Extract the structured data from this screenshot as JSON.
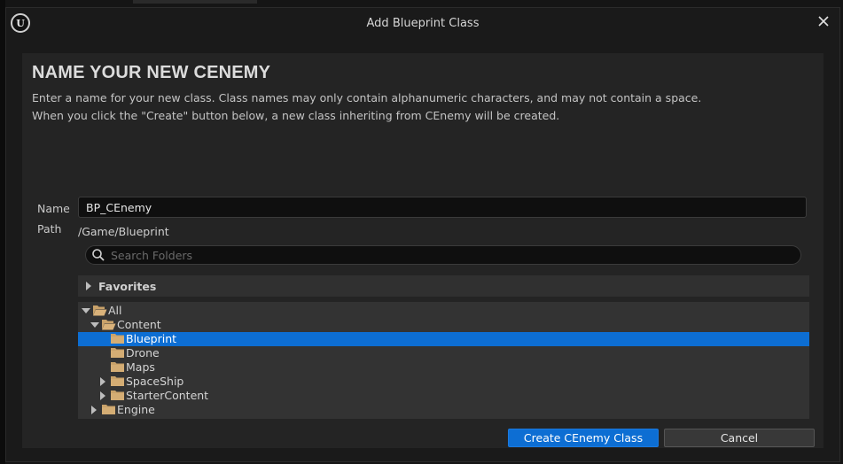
{
  "window": {
    "title": "Add Blueprint Class",
    "logo_text": "U"
  },
  "main": {
    "heading": "NAME YOUR NEW CENEMY",
    "description": [
      "Enter a name for your new class. Class names may only contain alphanumeric characters, and may not contain a space.",
      "When you click the \"Create\" button below, a new class inheriting from CEnemy will be created."
    ]
  },
  "form": {
    "name_label": "Name",
    "name_value": "BP_CEnemy",
    "path_label": "Path",
    "path_value": "/Game/Blueprint"
  },
  "search": {
    "placeholder": "Search Folders"
  },
  "favorites": {
    "label": "Favorites"
  },
  "tree": {
    "items": [
      {
        "label": "All",
        "depth": 0,
        "expanded": true,
        "open_folder": true
      },
      {
        "label": "Content",
        "depth": 1,
        "expanded": true,
        "open_folder": true
      },
      {
        "label": "Blueprint",
        "depth": 2,
        "selected": true
      },
      {
        "label": "Drone",
        "depth": 2
      },
      {
        "label": "Maps",
        "depth": 2
      },
      {
        "label": "SpaceShip",
        "depth": 2,
        "expandable": true
      },
      {
        "label": "StarterContent",
        "depth": 2,
        "expandable": true
      },
      {
        "label": "Engine",
        "depth": 1,
        "expandable": true
      }
    ]
  },
  "buttons": {
    "create_label": "Create CEnemy Class",
    "cancel_label": "Cancel"
  },
  "colors": {
    "accent": "#0d6ed3",
    "folder": "#c9a26a",
    "panel": "#242424",
    "background": "#1a1a1a"
  }
}
